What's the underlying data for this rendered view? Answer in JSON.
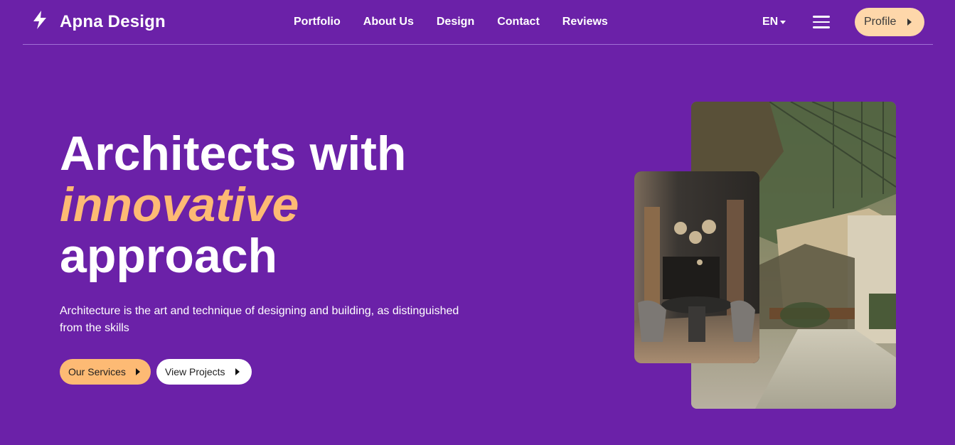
{
  "brand": {
    "name": "Apna Design",
    "icon": "lightning-bolt-icon"
  },
  "nav": {
    "links": [
      "Portfolio",
      "About Us",
      "Design",
      "Contact",
      "Reviews"
    ],
    "language": "EN",
    "profile_label": "Profile"
  },
  "hero": {
    "title_line1": "Architects with",
    "title_accent": "innovative",
    "title_line3": "approach",
    "description": "Architecture is the art and technique of designing and building, as distinguished from the skills",
    "primary_button": "Our Services",
    "secondary_button": "View Projects"
  },
  "colors": {
    "background": "#6b21a8",
    "accent": "#fdba74",
    "profile_button": "#fed7aa",
    "text": "#ffffff"
  },
  "images": {
    "back": "greenhouse-interior-photo",
    "front": "dining-room-interior-photo"
  }
}
